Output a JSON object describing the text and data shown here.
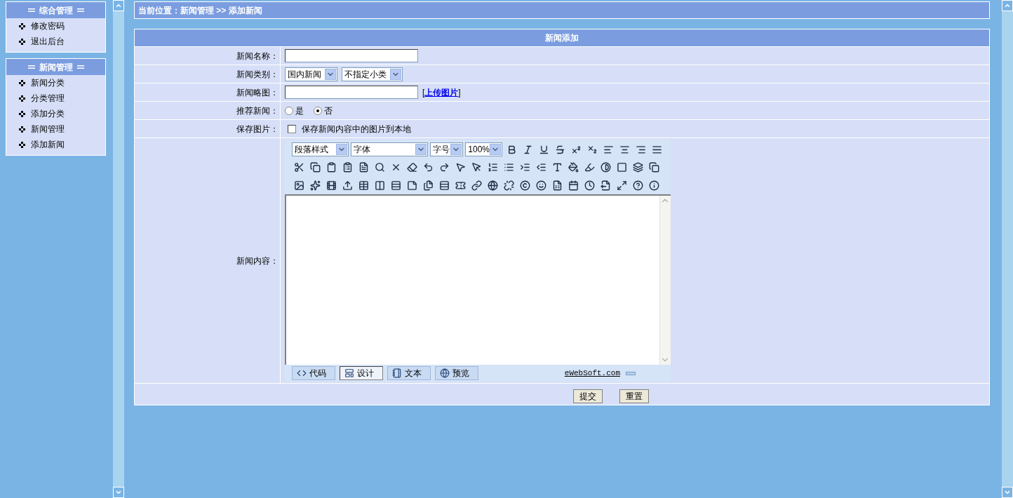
{
  "sidebar": {
    "panels": [
      {
        "title": "综合管理",
        "items": [
          "修改密码",
          "退出后台"
        ]
      },
      {
        "title": "新闻管理",
        "items": [
          "新闻分类",
          "分类管理",
          "添加分类",
          "新闻管理",
          "添加新闻"
        ]
      }
    ]
  },
  "breadcrumb": "当前位置：新闻管理 >> 添加新闻",
  "form": {
    "title": "新闻添加",
    "fields": [
      {
        "kind": "text",
        "label": "新闻名称："
      },
      {
        "kind": "selects",
        "label": "新闻类别：",
        "selects": [
          "国内新闻",
          "不指定小类"
        ]
      },
      {
        "kind": "upload",
        "label": "新闻略图：",
        "open": "[",
        "link": "上传图片",
        "close": "]"
      },
      {
        "kind": "radio",
        "label": "推荐新闻：",
        "options": [
          {
            "label": "是",
            "selected": false
          },
          {
            "label": "否",
            "selected": true
          }
        ]
      },
      {
        "kind": "checkbox",
        "label": "保存图片：",
        "text": "保存新闻内容中的图片到本地",
        "checked": false
      },
      {
        "kind": "editor",
        "label": "新闻内容："
      }
    ]
  },
  "editor": {
    "selects": [
      "段落样式",
      "字体",
      "字号",
      "100%"
    ],
    "modes": [
      {
        "label": "代码",
        "selected": false
      },
      {
        "label": "设计",
        "selected": true
      },
      {
        "label": "文本",
        "selected": false
      },
      {
        "label": "预览",
        "selected": false
      }
    ],
    "credit": "eWebSoft.com"
  },
  "buttons": [
    "提交",
    "重置"
  ]
}
